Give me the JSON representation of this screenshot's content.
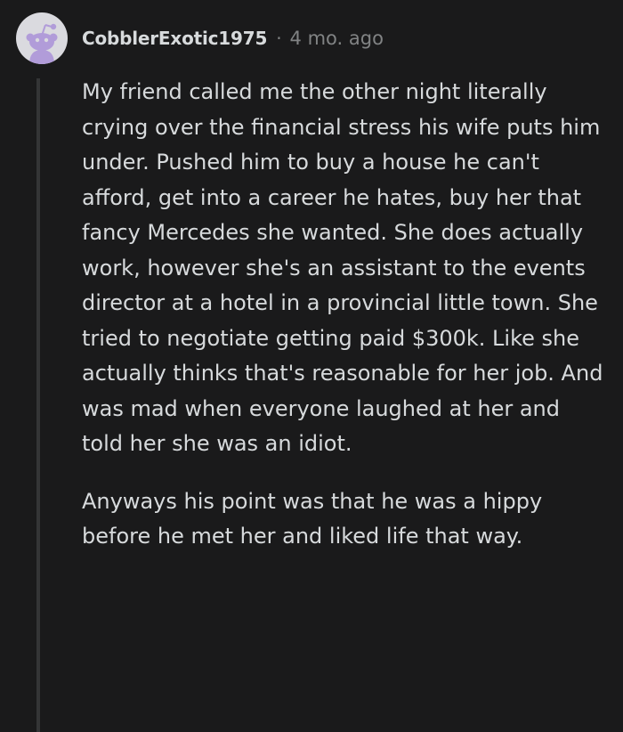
{
  "comment": {
    "username": "CobblerExotic1975",
    "separator": "·",
    "timestamp": "4 mo. ago",
    "avatar_icon": "snoo-avatar-icon",
    "paragraphs": [
      "My friend called me the other night literally crying over the financial stress his wife puts him under. Pushed him to buy a house he can't afford, get into a career he hates, buy her that fancy Mercedes she wanted. She does actually work, however she's an assistant to the events director at a hotel in a provincial little town. She tried to negotiate getting paid $300k. Like she actually thinks that's reasonable for her job. And was mad when everyone laughed at her and told her she was an idiot.",
      "Anyways his point was that he was a hippy before he met her and liked life that way."
    ]
  },
  "colors": {
    "background": "#1a1a1b",
    "text": "#d7dadc",
    "meta": "#818384",
    "thread_line": "#343536",
    "avatar_bg": "#dadadf",
    "avatar_snoo": "#b19cd9"
  }
}
